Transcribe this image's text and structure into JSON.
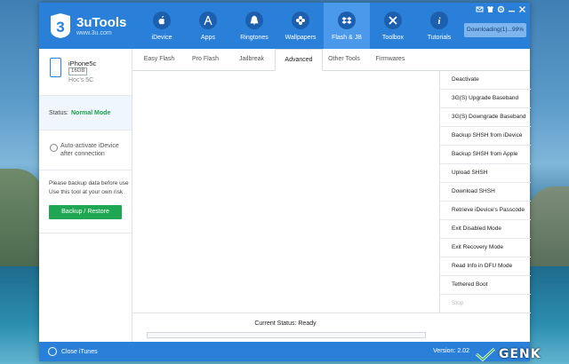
{
  "app": {
    "name": "3uTools",
    "url": "www.3u.com"
  },
  "nav": [
    {
      "label": "iDevice",
      "icon": "apple-icon"
    },
    {
      "label": "Apps",
      "icon": "app-store-icon"
    },
    {
      "label": "Ringtones",
      "icon": "bell-icon"
    },
    {
      "label": "Wallpapers",
      "icon": "flower-icon"
    },
    {
      "label": "Flash & JB",
      "icon": "dropbox-icon"
    },
    {
      "label": "Toolbox",
      "icon": "wrench-icon"
    },
    {
      "label": "Tutorials",
      "icon": "info-icon"
    }
  ],
  "active_nav": "Flash & JB",
  "download": {
    "label": "Downloading(1)...99%",
    "percent": 99
  },
  "device": {
    "name": "iPhone5c",
    "capacity": "16GB",
    "model": "Hoc's 5C"
  },
  "status": {
    "label": "Status:",
    "value": "Normal Mode"
  },
  "auto_activate": {
    "label": "Auto-activate iDevice after connection"
  },
  "backup": {
    "note": "Please backup data before use Use this tool at your own risk",
    "button": "Backup / Restore"
  },
  "tabs": [
    "Easy Flash",
    "Pro Flash",
    "Jailbreak",
    "Advanced",
    "Other Tools",
    "Firmwares"
  ],
  "active_tab": "Advanced",
  "actions": [
    {
      "label": "Deactivate",
      "enabled": true
    },
    {
      "label": "3G(S) Upgrade Baseband",
      "enabled": true
    },
    {
      "label": "3G(S) Downgrade Baseband",
      "enabled": true
    },
    {
      "label": "Backup SHSH from iDevice",
      "enabled": true
    },
    {
      "label": "Backup SHSH from Apple",
      "enabled": true
    },
    {
      "label": "Upload SHSH",
      "enabled": true
    },
    {
      "label": "Download SHSH",
      "enabled": true
    },
    {
      "label": "Retrieve iDevice's Passcode",
      "enabled": true
    },
    {
      "label": "Exit Disabled Mode",
      "enabled": true
    },
    {
      "label": "Exit Recovery Mode",
      "enabled": true
    },
    {
      "label": "Read Info in DFU Mode",
      "enabled": true
    },
    {
      "label": "Tethered Boot",
      "enabled": true
    },
    {
      "label": "Stop",
      "enabled": false
    }
  ],
  "current_status": "Current Status: Ready",
  "progress": {
    "percent": 0
  },
  "footer": {
    "close_itunes": "Close iTunes",
    "version": "Version: 2.02"
  },
  "watermark": {
    "text": "GENK"
  },
  "colors": {
    "brand": "#2a80d9",
    "status_ok": "#1aa04b",
    "backup_button": "#1fa652"
  }
}
